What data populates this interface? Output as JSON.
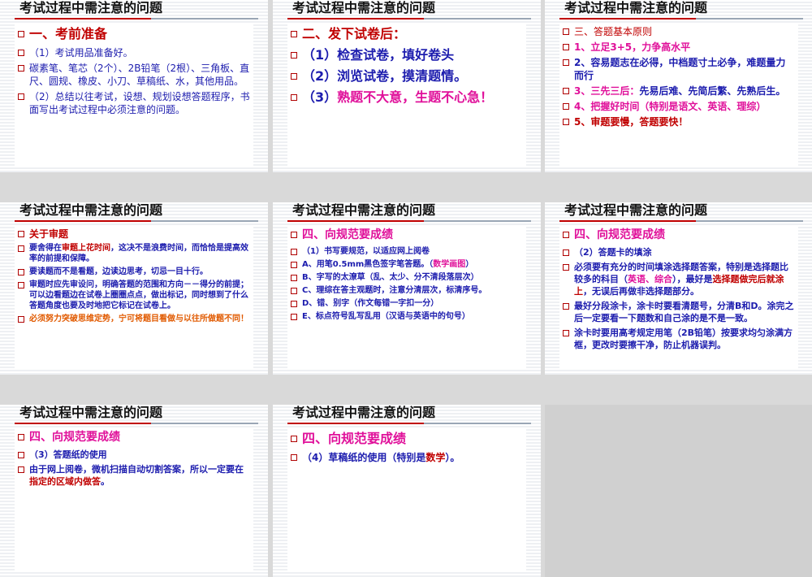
{
  "slides": [
    {
      "title": "考试过程中需注意的问题",
      "items": [
        {
          "segments": [
            {
              "t": "一、考前准备",
              "c": "red"
            }
          ],
          "size": 16,
          "bold": true,
          "bullet": true
        },
        {
          "segments": [
            {
              "t": "（1）考试用品准备好。",
              "c": "blue"
            }
          ],
          "size": 12,
          "bullet": true
        },
        {
          "segments": [
            {
              "t": "碳素笔、笔芯（2个）、2B铅笔（2根）、三角板、直尺、圆规、橡皮、小刀、草稿纸、水，其他用品。",
              "c": "blue"
            }
          ],
          "size": 12,
          "bullet": true
        },
        {
          "segments": [
            {
              "t": "（2）总结以往考试，设想、规划设想答题程序，书面写出考试过程中必须注意的问题。",
              "c": "blue"
            }
          ],
          "size": 12,
          "bullet": true
        }
      ]
    },
    {
      "title": "考试过程中需注意的问题",
      "items": [
        {
          "segments": [
            {
              "t": "二、发下试卷后：",
              "c": "red"
            }
          ],
          "size": 16,
          "bold": true,
          "bullet": true
        },
        {
          "segments": [
            {
              "t": "（1）检查试卷，填好卷头",
              "c": "blue"
            }
          ],
          "size": 16,
          "bold": true,
          "bullet": true
        },
        {
          "segments": [
            {
              "t": "（2）浏览试卷，摸清题情。",
              "c": "blue"
            }
          ],
          "size": 16,
          "bold": true,
          "bullet": true
        },
        {
          "segments": [
            {
              "t": "（3）",
              "c": "blue"
            },
            {
              "t": "熟题不大意，生题不心急！",
              "c": "pink"
            }
          ],
          "size": 16,
          "bold": true,
          "bullet": true
        }
      ]
    },
    {
      "title": "考试过程中需注意的问题",
      "items": [
        {
          "segments": [
            {
              "t": "三、答题基本原则",
              "c": "red"
            }
          ],
          "size": 12,
          "bullet": true
        },
        {
          "segments": [
            {
              "t": "1、立足3+5，力争高水平",
              "c": "pink"
            }
          ],
          "size": 12,
          "bold": true,
          "bullet": true
        },
        {
          "segments": [
            {
              "t": "2、容易题志在必得，中档题寸土必争，难题量力而行",
              "c": "blue"
            }
          ],
          "size": 12,
          "bold": true,
          "bullet": true
        },
        {
          "segments": [
            {
              "t": "3、三先三后：",
              "c": "pink"
            },
            {
              "t": "先易后难、先简后繁、先熟后生。",
              "c": "blue"
            }
          ],
          "size": 12,
          "bold": true,
          "bullet": true
        },
        {
          "segments": [
            {
              "t": "4、把握好时间（特别是语文、英语、理综）",
              "c": "pink"
            }
          ],
          "size": 12,
          "bold": true,
          "bullet": true
        },
        {
          "segments": [
            {
              "t": "5、审题要慢，答题要快！",
              "c": "red"
            }
          ],
          "size": 12,
          "bold": true,
          "bullet": true
        }
      ]
    },
    {
      "title": "考试过程中需注意的问题",
      "items": [
        {
          "segments": [
            {
              "t": "关于审题",
              "c": "red"
            }
          ],
          "size": 12,
          "bold": true,
          "bullet": true
        },
        {
          "segments": [
            {
              "t": "要舍得在",
              "c": "blue"
            },
            {
              "t": "审题上花时间",
              "c": "red"
            },
            {
              "t": "，这决不是浪费时间，而恰恰是提高效率的前提和保障。",
              "c": "blue"
            }
          ],
          "size": 10,
          "bold": true,
          "bullet": true
        },
        {
          "segments": [
            {
              "t": "要读题而不是看题，边读边思考，切忌一目十行。",
              "c": "blue"
            }
          ],
          "size": 10,
          "bold": true,
          "bullet": true
        },
        {
          "segments": [
            {
              "t": "审题时应先审设问，明确答题的范围和方向－－得分的前提；可以边看题边在试卷上圈圈点点，做出标记，同时想到了什么答题角度也要及时地把它标记在试卷上。",
              "c": "blue"
            }
          ],
          "size": 10,
          "bold": true,
          "bullet": true
        },
        {
          "segments": [
            {
              "t": "必须努力突破思维定势，宁可将题目看做与以往所做题不同！",
              "c": "orange"
            }
          ],
          "size": 10,
          "bold": true,
          "bullet": true
        }
      ]
    },
    {
      "title": "考试过程中需注意的问题",
      "items": [
        {
          "segments": [
            {
              "t": "四、向规范要成绩",
              "c": "pink"
            }
          ],
          "size": 14,
          "bold": true,
          "bullet": true
        },
        {
          "segments": [
            {
              "t": "（1）书写要规范，以适应网上阅卷",
              "c": "blue"
            }
          ],
          "size": 10,
          "bold": true,
          "bullet": true
        },
        {
          "segments": [
            {
              "t": "A、用笔0.5mm黑色签字笔答题。（",
              "c": "blue"
            },
            {
              "t": "数学画图",
              "c": "pink"
            },
            {
              "t": "）",
              "c": "blue"
            }
          ],
          "size": 10,
          "bold": true,
          "bullet": true
        },
        {
          "segments": [
            {
              "t": "B、字写的太潦草（乱、太少、分不清段落层次）",
              "c": "blue"
            }
          ],
          "size": 10,
          "bold": true,
          "bullet": true
        },
        {
          "segments": [
            {
              "t": "C、理综在答主观题时，注意分清层次，标清序号。",
              "c": "blue"
            }
          ],
          "size": 10,
          "bold": true,
          "bullet": true
        },
        {
          "segments": [
            {
              "t": "D、错、别字（作文每错一字扣一分）",
              "c": "blue"
            }
          ],
          "size": 10,
          "bold": true,
          "bullet": true
        },
        {
          "segments": [
            {
              "t": "E、标点符号乱写乱用（汉语与英语中的句号）",
              "c": "blue"
            }
          ],
          "size": 10,
          "bold": true,
          "bullet": true
        }
      ]
    },
    {
      "title": "考试过程中需注意的问题",
      "items": [
        {
          "segments": [
            {
              "t": "四、向规范要成绩",
              "c": "pink"
            }
          ],
          "size": 14,
          "bold": true,
          "bullet": true
        },
        {
          "segments": [
            {
              "t": "（2）答题卡的填涂",
              "c": "blue"
            }
          ],
          "size": 11,
          "bold": true,
          "bullet": true
        },
        {
          "segments": [
            {
              "t": "必须要有充分的时间填涂选择题答案，特别是选择题比较多的科目（",
              "c": "blue"
            },
            {
              "t": "英语、综合",
              "c": "pink"
            },
            {
              "t": "），最好是",
              "c": "blue"
            },
            {
              "t": "选择题做完后就涂上",
              "c": "red"
            },
            {
              "t": "，无误后再做非选择题部分。",
              "c": "blue"
            }
          ],
          "size": 11,
          "bold": true,
          "bullet": true
        },
        {
          "segments": [
            {
              "t": "最好分段涂卡，涂卡时要看清题号，分清B和D。涂完之后一定要看一下题数和自己涂的是不是一致。",
              "c": "blue"
            }
          ],
          "size": 11,
          "bold": true,
          "bullet": true
        },
        {
          "segments": [
            {
              "t": "涂卡时要用高考规定用笔（2B铅笔）按要求均匀涂满方框，更改时要擦干净，防止机器误判。",
              "c": "blue"
            }
          ],
          "size": 11,
          "bold": true,
          "bullet": true
        }
      ]
    },
    {
      "title": "考试过程中需注意的问题",
      "items": [
        {
          "segments": [
            {
              "t": "四、向规范要成绩",
              "c": "pink"
            }
          ],
          "size": 14,
          "bold": true,
          "bullet": true
        },
        {
          "segments": [
            {
              "t": "（3）答题纸的使用",
              "c": "blue"
            }
          ],
          "size": 11,
          "bold": true,
          "bullet": true
        },
        {
          "segments": [
            {
              "t": "由于网上阅卷，微机扫描自动切割答案，所以一定要在",
              "c": "blue"
            },
            {
              "t": "指定的区域内做答",
              "c": "red"
            },
            {
              "t": "。",
              "c": "blue"
            }
          ],
          "size": 11,
          "bold": true,
          "bullet": true
        }
      ]
    },
    {
      "title": "考试过程中需注意的问题",
      "items": [
        {
          "segments": [
            {
              "t": "四、向规范要成绩",
              "c": "pink"
            }
          ],
          "size": 16,
          "bold": true,
          "bullet": true
        },
        {
          "segments": [
            {
              "t": "（4）草稿纸的使用（特别是",
              "c": "blue"
            },
            {
              "t": "数学",
              "c": "red"
            },
            {
              "t": "）。",
              "c": "blue"
            }
          ],
          "size": 12,
          "bold": true,
          "bullet": true
        }
      ]
    }
  ]
}
